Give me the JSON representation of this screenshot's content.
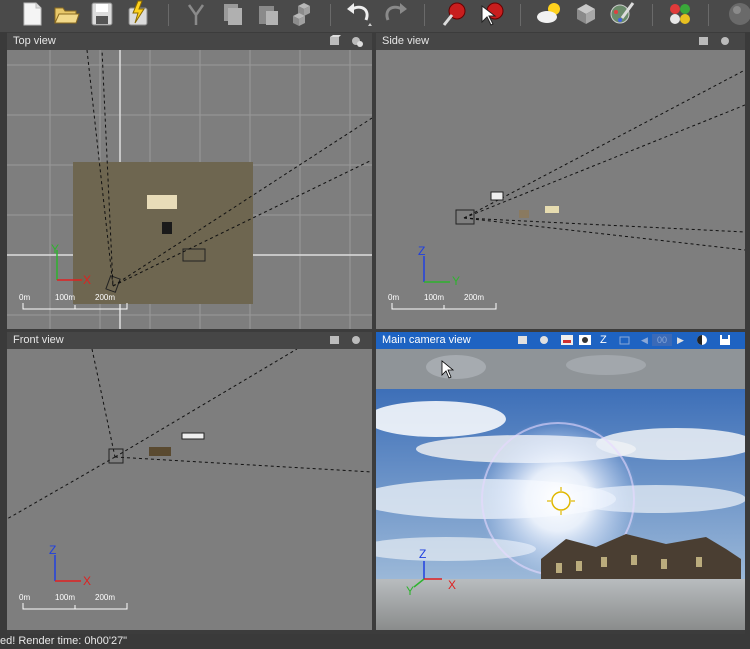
{
  "toolbar": {
    "buttons": [
      "new-document-icon",
      "open-folder-icon",
      "save-icon",
      "save-lightning-icon",
      "selection-tool-icon",
      "copy-icon",
      "paste-icon",
      "cubes-icon",
      "undo-icon",
      "redo-icon",
      "render-icon",
      "render-area-icon",
      "sky-icon",
      "object-icon",
      "brush-icon",
      "colors-icon",
      "sphere-icon"
    ]
  },
  "viewports": {
    "top": {
      "title": "Top view",
      "scale": [
        "0m",
        "100m",
        "200m"
      ],
      "axis1": "Y",
      "axis2": "X"
    },
    "side": {
      "title": "Side view",
      "scale": [
        "0m",
        "100m",
        "200m"
      ],
      "axis1": "Z",
      "axis2": "Y"
    },
    "front": {
      "title": "Front view",
      "scale": [
        "0m",
        "100m",
        "200m"
      ],
      "axis1": "Z",
      "axis2": "X"
    },
    "camera": {
      "title": "Main camera view",
      "z_label": "Z",
      "field_value": "00",
      "axis1": "Z",
      "axis2": "Y",
      "axis3": "X"
    }
  },
  "status": {
    "text": "ed! Render time: 0h00'27\""
  },
  "colors": {
    "active_header": "#1e63c2",
    "viewport_bg": "#7e7e7e",
    "terrain": "#6e6650"
  }
}
